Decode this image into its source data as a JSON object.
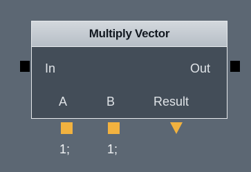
{
  "node": {
    "title": "Multiply Vector",
    "flow_in_label": "In",
    "flow_out_label": "Out",
    "ports": [
      {
        "label": "A",
        "value": "1;",
        "kind": "input"
      },
      {
        "label": "B",
        "value": "1;",
        "kind": "input"
      },
      {
        "label": "Result",
        "kind": "output"
      }
    ]
  },
  "colors": {
    "canvas": "#5c6773",
    "node_body": "#434d58",
    "header": "#c6ccd2",
    "port": "#f2b23f",
    "flow_pin": "#000000"
  },
  "icons": {
    "flow_in": "square-pin",
    "flow_out": "square-pin",
    "input_port": "square",
    "output_port": "down-triangle"
  }
}
